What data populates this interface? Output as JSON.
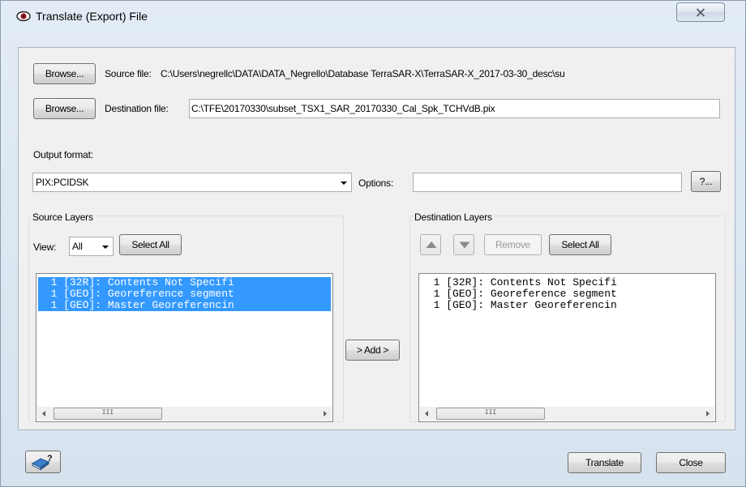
{
  "window": {
    "title": "Translate (Export) File",
    "title_icon": "eye-icon",
    "close_icon": "close-icon"
  },
  "source": {
    "browse_label": "Browse...",
    "label": "Source file:",
    "path": "C:\\Users\\negrellc\\DATA\\DATA_Negrello\\Database TerraSAR-X\\TerraSAR-X_2017-03-30_desc\\su"
  },
  "destination": {
    "browse_label": "Browse...",
    "label": "Destination file:",
    "path": "C:\\TFE\\20170330\\subset_TSX1_SAR_20170330_Cal_Spk_TCHVdB.pix"
  },
  "output_format": {
    "label": "Output format:",
    "selected": "PIX:PCIDSK",
    "options_label": "Options:",
    "options_value": "",
    "options_button": "?..."
  },
  "source_layers": {
    "title": "Source Layers",
    "view_label": "View:",
    "view_selected": "All",
    "select_all_label": "Select All",
    "items": [
      "  1 [32R]: Contents Not Specifi",
      "  1 [GEO]: Georeference segment",
      "  1 [GEO]: Master Georeferencin"
    ],
    "scroll_thumb": "III"
  },
  "add_button": "> Add >",
  "destination_layers": {
    "title": "Destination Layers",
    "up_icon": "triangle-up-icon",
    "down_icon": "triangle-down-icon",
    "remove_label": "Remove",
    "select_all_label": "Select All",
    "items": [
      "  1 [32R]: Contents Not Specifi",
      "  1 [GEO]: Georeference segment",
      "  1 [GEO]: Master Georeferencin"
    ],
    "scroll_thumb": "III"
  },
  "footer": {
    "help_icon": "help-book-icon",
    "translate_label": "Translate",
    "close_label": "Close"
  }
}
